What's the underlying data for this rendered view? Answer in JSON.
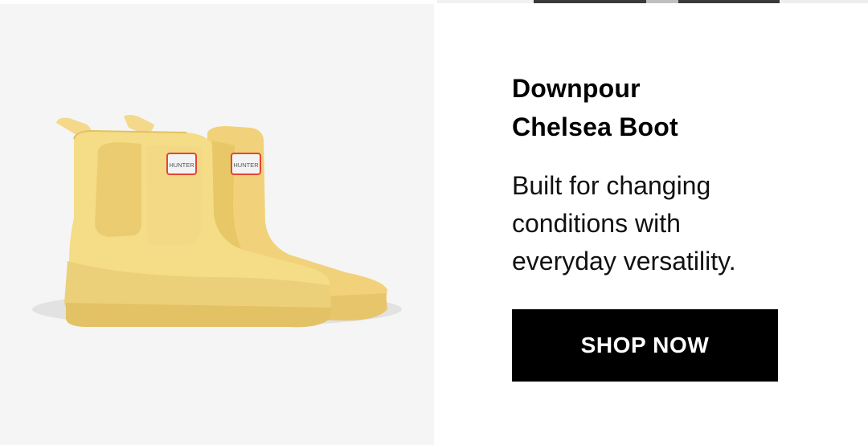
{
  "product": {
    "title_lines": [
      "Downpour",
      "Chelsea Boot"
    ],
    "description_lines": [
      "Built for changing",
      "conditions with",
      "everyday versatility."
    ],
    "cta_label": "SHOP NOW",
    "image": {
      "icon": "chelsea-boot-image",
      "label_text": "HUNTER",
      "colors": {
        "background": "#f5f5f5",
        "boot": "#f5dc86",
        "boot_shade": "#e9c96a",
        "sole": "#eed27a",
        "label_red": "#e5452f"
      }
    }
  }
}
